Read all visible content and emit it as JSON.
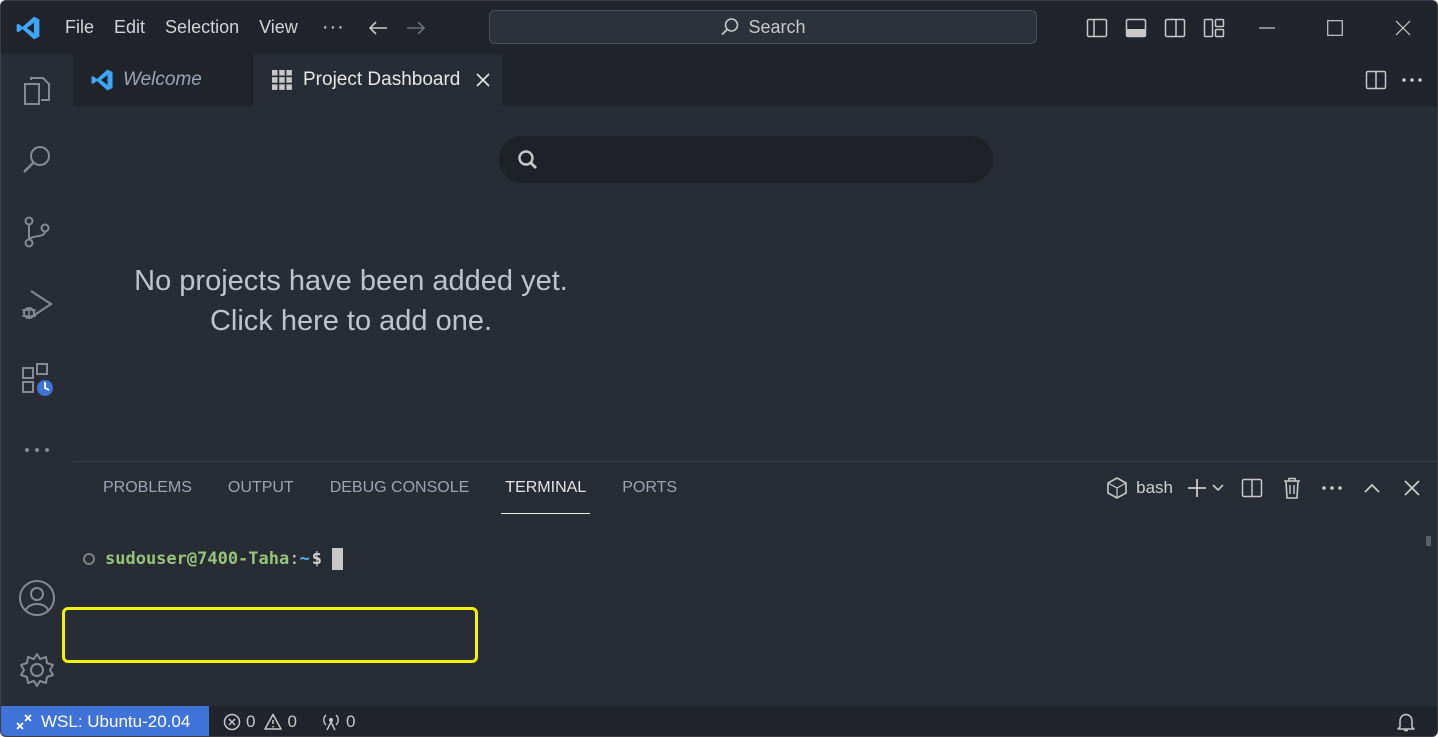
{
  "titlebar": {
    "menu": [
      "File",
      "Edit",
      "Selection",
      "View"
    ],
    "more": "···",
    "search_label": "Search"
  },
  "tabs": {
    "welcome": "Welcome",
    "dashboard": "Project Dashboard"
  },
  "dashboard": {
    "search_placeholder": "",
    "empty_line1": "No projects have been added yet.",
    "empty_line2": "Click here to add one."
  },
  "panel": {
    "tabs": [
      "PROBLEMS",
      "OUTPUT",
      "DEBUG CONSOLE",
      "TERMINAL",
      "PORTS"
    ],
    "active_tab": "TERMINAL",
    "shell": "bash"
  },
  "terminal": {
    "user_host": "sudouser@7400-Taha",
    "separator": ":",
    "path": "~",
    "prompt": "$"
  },
  "statusbar": {
    "remote": "WSL: Ubuntu-20.04",
    "errors": "0",
    "warnings": "0",
    "ports": "0"
  },
  "colors": {
    "accent": "#3f73d8",
    "highlight": "#f2f20c",
    "terminal_user": "#98c379",
    "terminal_path": "#61afef",
    "vscode_logo": "#3ea6f2"
  }
}
